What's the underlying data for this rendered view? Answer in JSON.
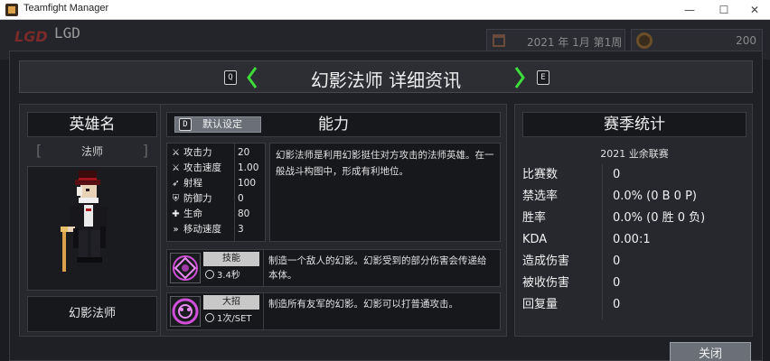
{
  "window": {
    "title": "Teamfight Manager",
    "minimize": "—",
    "maximize": "☐",
    "close": "✕"
  },
  "hud": {
    "team_name": "LGD",
    "date": "2021 年 1月 第1周",
    "coins": "200"
  },
  "modal": {
    "title": "幻影法师 详细资讯",
    "prev_key": "Q",
    "next_key": "E",
    "close_label": "关闭"
  },
  "hero": {
    "header": "英雄名",
    "role": "法师",
    "name": "幻影法师"
  },
  "ability_panel": {
    "header": "能力",
    "default_key": "D",
    "default_label": "默认设定",
    "stats": [
      {
        "icon": "attack-icon",
        "label": "攻击力",
        "value": "20"
      },
      {
        "icon": "attack-speed-icon",
        "label": "攻击速度",
        "value": "1.00"
      },
      {
        "icon": "range-icon",
        "label": "射程",
        "value": "100"
      },
      {
        "icon": "defense-icon",
        "label": "防御力",
        "value": "0"
      },
      {
        "icon": "health-icon",
        "label": "生命",
        "value": "80"
      },
      {
        "icon": "move-speed-icon",
        "label": "移动速度",
        "value": "3"
      }
    ],
    "description": "幻影法师是利用幻影挺住对方攻击的法师英雄。在一般战斗构图中，形成有利地位。",
    "skill": {
      "tag": "技能",
      "cooldown": "3.4秒",
      "description": "制造一个敌人的幻影。幻影受到的部分伤害会传递给本体。"
    },
    "ultimate": {
      "tag": "大招",
      "cooldown": "1次/SET",
      "description": "制造所有友军的幻影。幻影可以打普通攻击。"
    }
  },
  "season": {
    "header": "赛季统计",
    "league": "2021 业余联赛",
    "rows": [
      {
        "label": "比赛数",
        "value": "0"
      },
      {
        "label": "禁选率",
        "value": "0.0% (0 B 0 P)"
      },
      {
        "label": "胜率",
        "value": "0.0% (0 胜 0 负)"
      },
      {
        "label": "KDA",
        "value": "0.00:1"
      },
      {
        "label": "造成伤害",
        "value": "0"
      },
      {
        "label": "被收伤害",
        "value": "0"
      },
      {
        "label": "回复量",
        "value": "0"
      }
    ]
  },
  "colors": {
    "accent_green": "#3ddc3a",
    "skill_pink": "#d04fd8"
  }
}
